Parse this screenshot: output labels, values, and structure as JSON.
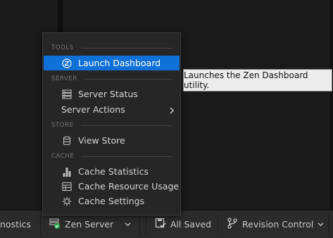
{
  "menu": {
    "sections": {
      "tools": "TOOLS",
      "server": "SERVER",
      "store": "STORE",
      "cache": "CACHE"
    },
    "items": {
      "launch_dashboard": "Launch Dashboard",
      "server_status": "Server Status",
      "server_actions": "Server Actions",
      "view_store": "View Store",
      "cache_statistics": "Cache Statistics",
      "cache_resource_usage": "Cache Resource Usage",
      "cache_settings": "Cache Settings"
    },
    "highlight_color": "#0f70d7"
  },
  "tooltip": {
    "text": "Launches the Zen Dashboard utility."
  },
  "statusbar": {
    "diagnostics": "nostics",
    "zen_server": "Zen Server",
    "all_saved": "All Saved",
    "revision_control": "Revision Control"
  }
}
